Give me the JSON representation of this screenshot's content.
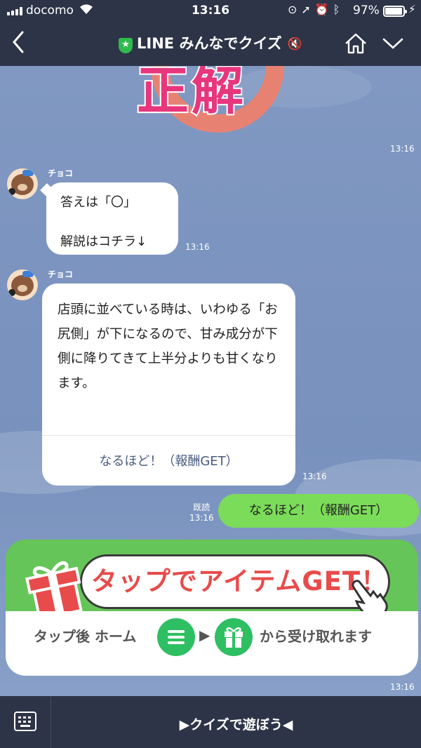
{
  "status": {
    "carrier": "docomo",
    "time": "13:16",
    "battery": "97%",
    "battery_level": 0.97
  },
  "nav": {
    "title": "LINE みんなでクイズ",
    "shield_glyph": "★",
    "mute_glyph": "🔇"
  },
  "result_stamp": {
    "text": "正解"
  },
  "messages": {
    "stamp_time": "13:16",
    "m1": {
      "sender": "チョコ",
      "line1": "答えは「〇」",
      "line2": "解説はコチラ↓",
      "time": "13:16"
    },
    "m2": {
      "sender": "チョコ",
      "text": "店頭に並べている時は、いわゆる「お尻側」が下になるので、甘み成分が下側に降りてきて上半分よりも甘くなります。",
      "action": "なるほど！（報酬GET）",
      "time": "13:16"
    },
    "m3": {
      "read_label": "既読",
      "time": "13:16",
      "text": "なるほど！（報酬GET）"
    }
  },
  "banner": {
    "cta": "タップでアイテムGET！",
    "lower_left": "タップ後 ホーム",
    "arrow": "▶",
    "lower_right": "から受け取れます",
    "time": "13:16"
  },
  "bottom": {
    "label": "▶クイズで遊ぼう◀"
  },
  "colors": {
    "bar": "#2d3447",
    "chat_bg": "#7a93bf",
    "own_bubble": "#7bdc59",
    "cta_red": "#e84b4b",
    "banner_green": "#66c558"
  }
}
